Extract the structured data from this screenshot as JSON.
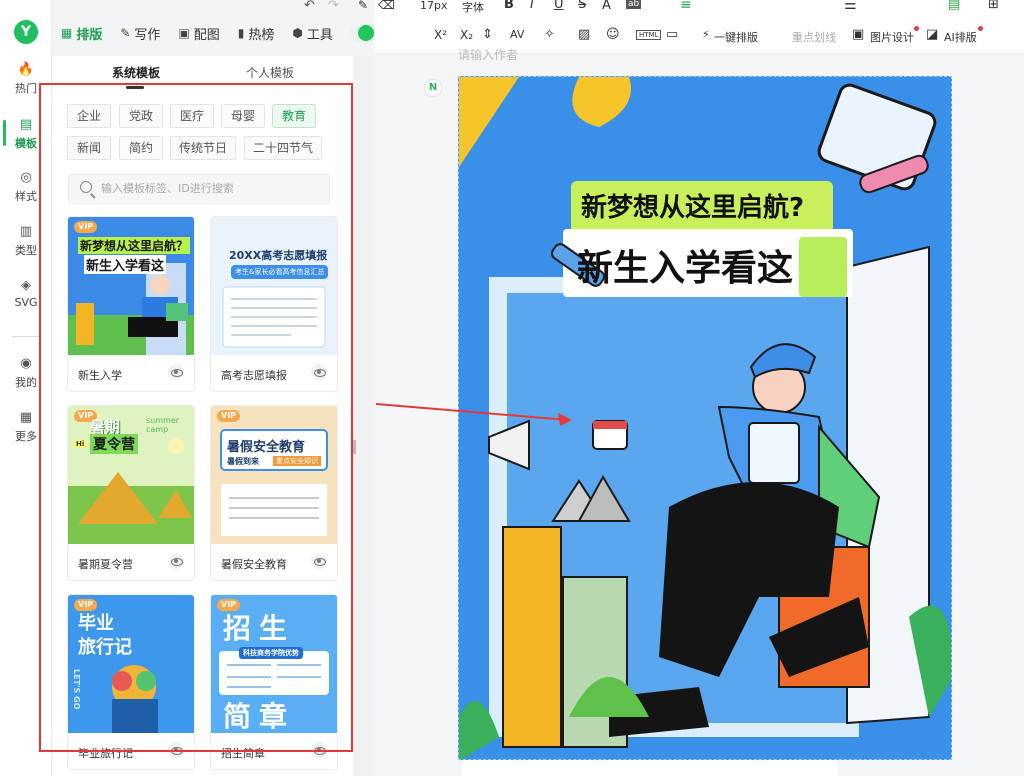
{
  "rail": [
    {
      "icon": "🔥",
      "label": "热门"
    },
    {
      "icon": "▤",
      "label": "模板"
    },
    {
      "icon": "◎",
      "label": "样式"
    },
    {
      "icon": "▥",
      "label": "类型"
    },
    {
      "icon": "◈",
      "label": "SVG"
    },
    {
      "icon": "◉",
      "label": "我的"
    },
    {
      "icon": "▦",
      "label": "更多"
    }
  ],
  "top_tabs": [
    {
      "icon": "▦",
      "label": "排版"
    },
    {
      "icon": "✎",
      "label": "写作"
    },
    {
      "icon": "▣",
      "label": "配图"
    },
    {
      "icon": "▮",
      "label": "热榜"
    },
    {
      "icon": "⬢",
      "label": "工具"
    }
  ],
  "panel": {
    "tab_system": "系统模板",
    "tab_personal": "个人模板",
    "chips": [
      "企业",
      "党政",
      "医疗",
      "母婴",
      "教育",
      "新闻",
      "简约",
      "传统节日",
      "二十四节气"
    ],
    "search_placeholder": "输入模板标签、ID进行搜索",
    "cards": [
      {
        "label": "新生入学",
        "title": "新梦想从这里启航？",
        "subtitle": "新生入学看这",
        "vip": "VIP"
      },
      {
        "label": "高考志愿填报",
        "title": "20XX高考志愿填报",
        "subtitle": "考生&家长必看高考信息汇总",
        "vip": ""
      },
      {
        "label": "暑期夏令营",
        "title": "暑期",
        "subtitle": "夏令营",
        "vip": "VIP",
        "extra": "summer camp",
        "hi": "Hi"
      },
      {
        "label": "暑假安全教育",
        "title": "暑假安全教育",
        "subtitle": "暑假到来",
        "vip": "VIP",
        "extra": "重点安全知识"
      },
      {
        "label": "毕业旅行记",
        "title": "毕业",
        "subtitle": "旅行记",
        "vip": "VIP",
        "extra": "LET'S GO"
      },
      {
        "label": "招生简章",
        "title": "招生",
        "subtitle": "简章",
        "vip": "VIP",
        "extra": "科技商务学院优势"
      }
    ]
  },
  "toolbar": {
    "font_size": "17px",
    "font_family": "字体",
    "bold": "B",
    "italic": "I",
    "underline": "U",
    "strike": "S",
    "sup": "X²",
    "sub": "X₂",
    "one_click": "一键排版",
    "highlight": "重点划线",
    "image_design": "图片设计",
    "ai_layout": "AI排版",
    "html": "HTML"
  },
  "canvas": {
    "ghost_text": "请输入作者",
    "badge": "N",
    "poster_title": "新梦想从这里启航?",
    "poster_subtitle": "新生入学看这"
  }
}
